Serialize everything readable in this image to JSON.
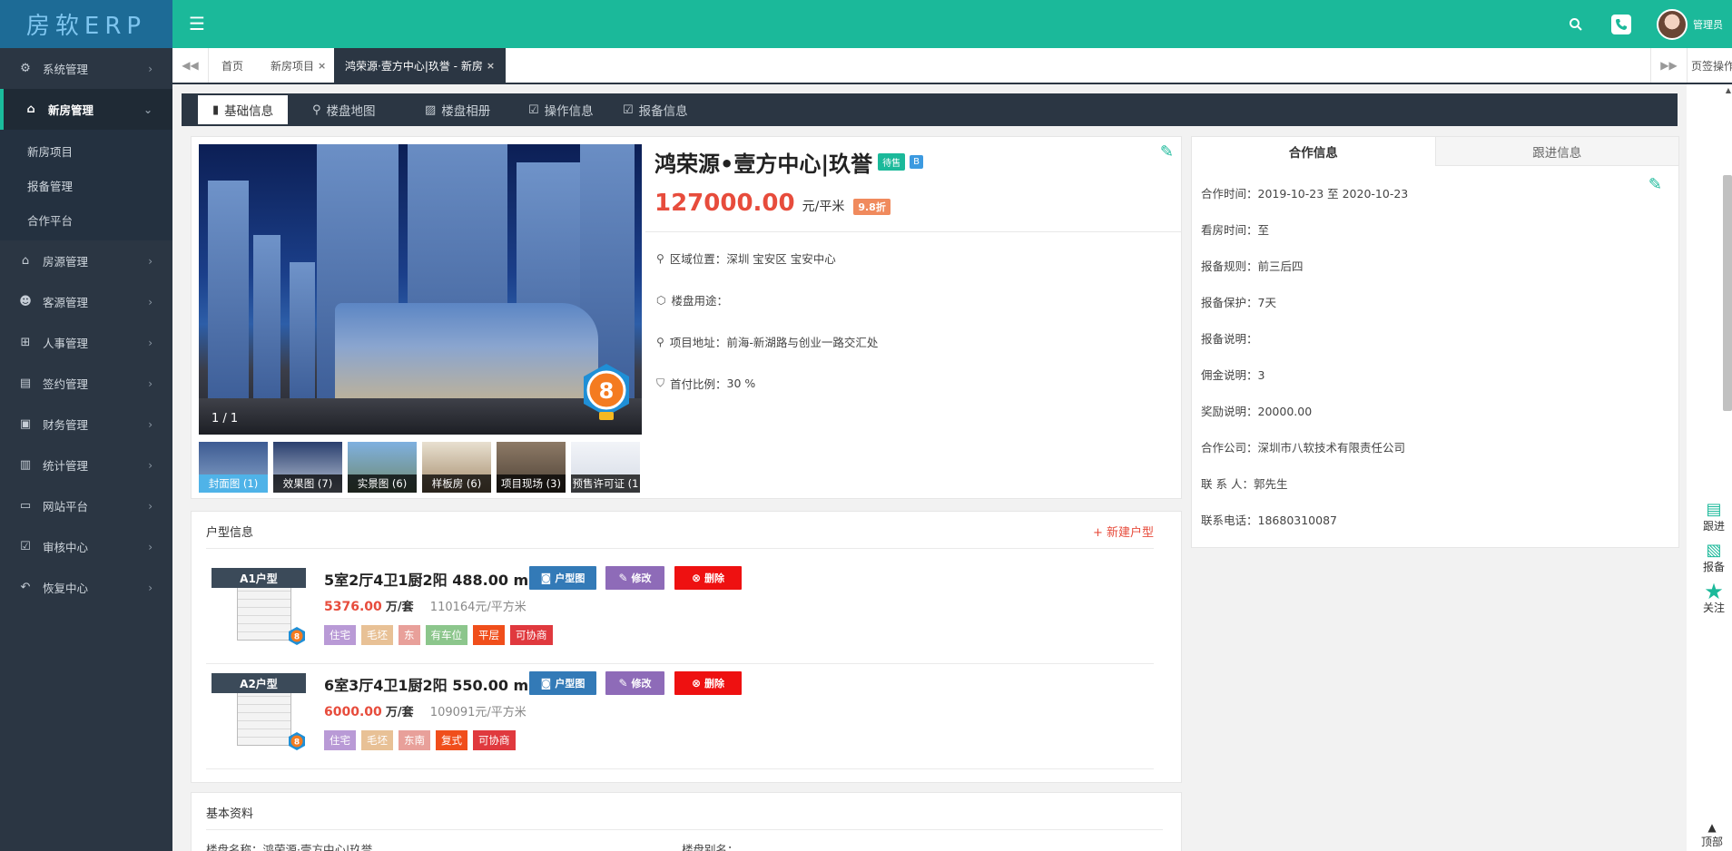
{
  "app": {
    "logo": "房软ERP"
  },
  "sidebar": {
    "items": [
      {
        "label": "系统管理",
        "icon": "gear-icon",
        "arrow": "›"
      },
      {
        "label": "新房管理",
        "icon": "house-icon",
        "arrow": "⌄"
      },
      {
        "label": "房源管理",
        "icon": "home-icon",
        "arrow": "›"
      },
      {
        "label": "客源管理",
        "icon": "users-icon",
        "arrow": "›"
      },
      {
        "label": "人事管理",
        "icon": "org-icon",
        "arrow": "›"
      },
      {
        "label": "签约管理",
        "icon": "contract-icon",
        "arrow": "›"
      },
      {
        "label": "财务管理",
        "icon": "wallet-icon",
        "arrow": "›"
      },
      {
        "label": "统计管理",
        "icon": "chart-icon",
        "arrow": "›"
      },
      {
        "label": "网站平台",
        "icon": "monitor-icon",
        "arrow": "›"
      },
      {
        "label": "审核中心",
        "icon": "check-icon",
        "arrow": "›"
      },
      {
        "label": "恢复中心",
        "icon": "undo-icon",
        "arrow": "›"
      }
    ],
    "submenu": [
      "新房项目",
      "报备管理",
      "合作平台"
    ]
  },
  "topbar": {
    "hamburger": "☰",
    "admin": "管理员"
  },
  "tabs": {
    "prev": "◀◀",
    "next": "▶▶",
    "items": [
      {
        "label": "首页",
        "close": ""
      },
      {
        "label": "新房项目",
        "close": "×"
      },
      {
        "label": "鸿荣源·壹方中心|玖誉 - 新房",
        "close": "×"
      }
    ],
    "ops": "页签操作 ▾"
  },
  "subtabs": [
    {
      "label": "基础信息",
      "icon": "building-icon"
    },
    {
      "label": "楼盘地图",
      "icon": "map-pin-icon"
    },
    {
      "label": "楼盘相册",
      "icon": "image-icon"
    },
    {
      "label": "操作信息",
      "icon": "edit-icon"
    },
    {
      "label": "报备信息",
      "icon": "report-icon"
    }
  ],
  "property": {
    "title": "鸿荣源•壹方中心|玖誉",
    "status_tag": "待售",
    "grade_tag": "B",
    "price": "127000.00",
    "price_unit": "元/平米",
    "discount": "9.8折",
    "image_counter": "1 / 1",
    "badge_number": "8",
    "info": [
      {
        "label": "区域位置：",
        "value": "深圳 宝安区 宝安中心"
      },
      {
        "label": "楼盘用途：",
        "value": ""
      },
      {
        "label": "项目地址：",
        "value": "前海-新湖路与创业一路交汇处"
      },
      {
        "label": "首付比例：",
        "value": "30 %"
      }
    ],
    "thumbs": [
      "封面图 (1)",
      "效果图 (7)",
      "实景图 (6)",
      "样板房 (6)",
      "项目现场 (3)",
      "预售许可证 (1"
    ]
  },
  "cooperation": {
    "tabs": [
      "合作信息",
      "跟进信息"
    ],
    "rows": [
      {
        "label": "合作时间：",
        "value": "2019-10-23 至 2020-10-23"
      },
      {
        "label": "看房时间：",
        "value": "至"
      },
      {
        "label": "报备规则：",
        "value": "前三后四"
      },
      {
        "label": "报备保护：",
        "value": "7天"
      },
      {
        "label": "报备说明：",
        "value": ""
      },
      {
        "label": "佣金说明：",
        "value": "3"
      },
      {
        "label": "奖励说明：",
        "value": "20000.00"
      },
      {
        "label": "合作公司：",
        "value": "深圳市八软技术有限责任公司"
      },
      {
        "label": "联 系 人：",
        "value": "郭先生"
      },
      {
        "label": "联系电话：",
        "value": "18680310087"
      }
    ]
  },
  "units": {
    "title": "户型信息",
    "new_button": "+ 新建户型",
    "btn_plan": "户型图",
    "btn_edit": "修改",
    "btn_delete": "删除",
    "items": [
      {
        "label": "A1户型",
        "desc": "5室2厅4卫1厨2阳 488.00 m²",
        "price": "5376.00",
        "price_unit": "万/套",
        "per_sqm": "110164元/平方米",
        "tags": [
          {
            "text": "住宅",
            "color": "#b99ad6"
          },
          {
            "text": "毛坯",
            "color": "#e8c196"
          },
          {
            "text": "东",
            "color": "#e8a09a"
          },
          {
            "text": "有车位",
            "color": "#8cc68c"
          },
          {
            "text": "平层",
            "color": "#f04e1b"
          },
          {
            "text": "可协商",
            "color": "#e0393e"
          }
        ]
      },
      {
        "label": "A2户型",
        "desc": "6室3厅4卫1厨2阳 550.00 m²",
        "price": "6000.00",
        "price_unit": "万/套",
        "per_sqm": "109091元/平方米",
        "tags": [
          {
            "text": "住宅",
            "color": "#b99ad6"
          },
          {
            "text": "毛坯",
            "color": "#e8c196"
          },
          {
            "text": "东南",
            "color": "#e8a09a"
          },
          {
            "text": "复式",
            "color": "#f04e1b"
          },
          {
            "text": "可协商",
            "color": "#e0393e"
          }
        ]
      }
    ]
  },
  "basic": {
    "title": "基本资料",
    "name_label": "楼盘名称：",
    "name_value": "鸿荣源·壹方中心|玖誉",
    "alias_label": "楼盘别名："
  },
  "float_actions": [
    "跟进",
    "报备",
    "关注"
  ],
  "back_top": "顶部",
  "colors": {
    "primary": "#1bb99a",
    "sidebar": "#2b3643",
    "price": "#e74c3c"
  }
}
